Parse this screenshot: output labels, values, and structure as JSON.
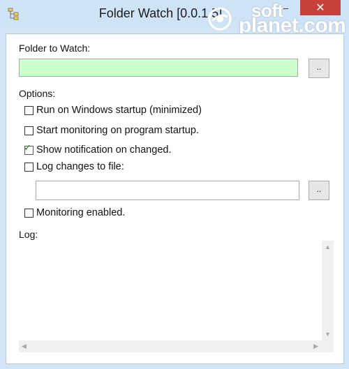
{
  "window": {
    "title": "Folder Watch [0.0.1.5]",
    "minimize_glyph": "—",
    "close_glyph": "✕"
  },
  "watermark": {
    "line1": "soft",
    "line2": "planet.com"
  },
  "folder": {
    "label": "Folder to Watch:",
    "value": "",
    "browse_label": ".."
  },
  "options": {
    "label": "Options:",
    "items": [
      {
        "label": "Run on Windows startup (minimized)",
        "checked": false
      },
      {
        "label": "Start monitoring on program startup.",
        "checked": false
      },
      {
        "label": "Show notification on changed.",
        "checked": true
      },
      {
        "label": "Log changes to file:",
        "checked": false
      }
    ],
    "log_file_value": "",
    "log_browse_label": "..",
    "monitoring": {
      "label": "Monitoring enabled.",
      "checked": false
    }
  },
  "log": {
    "label": "Log:",
    "content": ""
  },
  "icons": {
    "app": "folder-tree-icon",
    "scroll_up": "▲",
    "scroll_down": "▼",
    "scroll_left": "◀",
    "scroll_right": "▶"
  },
  "colors": {
    "folder_input_bg": "#ccffcc",
    "close_button": "#c7403a",
    "check_mark": "#1a8a1a"
  }
}
